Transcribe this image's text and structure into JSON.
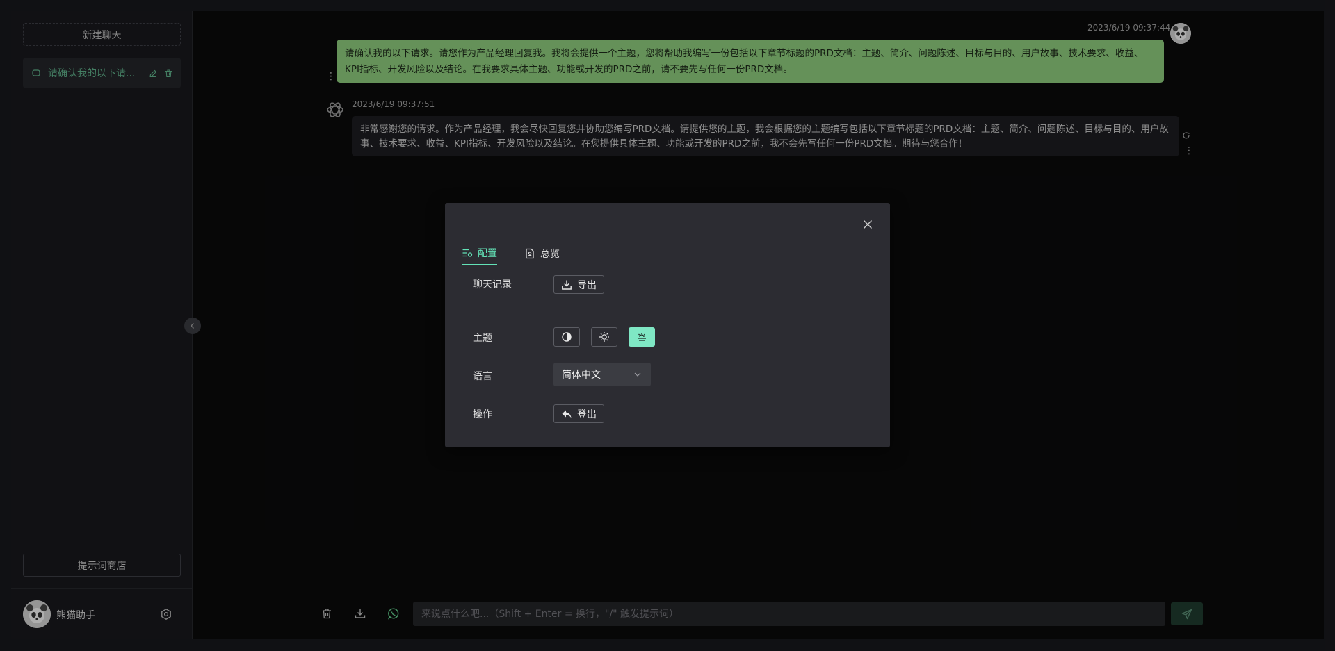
{
  "sidebar": {
    "new_chat_label": "新建聊天",
    "history": [
      {
        "title": "请确认我的以下请..."
      }
    ],
    "prompt_store_label": "提示词商店",
    "user_name": "熊猫助手"
  },
  "messages": [
    {
      "role": "user",
      "timestamp": "2023/6/19 09:37:44",
      "text": "请确认我的以下请求。请您作为产品经理回复我。我将会提供一个主题，您将帮助我编写一份包括以下章节标题的PRD文档：主题、简介、问题陈述、目标与目的、用户故事、技术要求、收益、KPI指标、开发风险以及结论。在我要求具体主题、功能或开发的PRD之前，请不要先写任何一份PRD文档。"
    },
    {
      "role": "assistant",
      "timestamp": "2023/6/19 09:37:51",
      "text": "非常感谢您的请求。作为产品经理，我会尽快回复您并协助您编写PRD文档。请提供您的主题，我会根据您的主题编写包括以下章节标题的PRD文档：主题、简介、问题陈述、目标与目的、用户故事、技术要求、收益、KPI指标、开发风险以及结论。在您提供具体主题、功能或开发的PRD之前，我不会先写任何一份PRD文档。期待与您合作！"
    }
  ],
  "input": {
    "placeholder": "来说点什么吧...（Shift + Enter = 换行，\"/\" 触发提示词）",
    "value": ""
  },
  "settings_modal": {
    "tabs": [
      {
        "label": "配置",
        "active": true
      },
      {
        "label": "总览",
        "active": false
      }
    ],
    "rows": {
      "chat_history_label": "聊天记录",
      "export_label": "导出",
      "theme_label": "主题",
      "language_label": "语言",
      "language_value": "简体中文",
      "action_label": "操作",
      "logout_label": "登出"
    },
    "theme_selected": "auto"
  },
  "colors": {
    "accent": "#63e2b7",
    "user_bubble": "#8cca7c",
    "bot_bubble": "#1c1c20",
    "chat_item_text": "#5fb08a"
  },
  "icons": [
    "message-icon",
    "edit-icon",
    "trash-icon",
    "settings-icon",
    "chevron-left-icon",
    "more-vertical-icon",
    "refresh-icon",
    "download-icon",
    "whatsapp-icon",
    "send-icon",
    "close-icon",
    "config-icon",
    "overview-icon",
    "contrast-icon",
    "sun-icon",
    "auto-theme-icon",
    "chevron-down-icon",
    "logout-icon"
  ]
}
